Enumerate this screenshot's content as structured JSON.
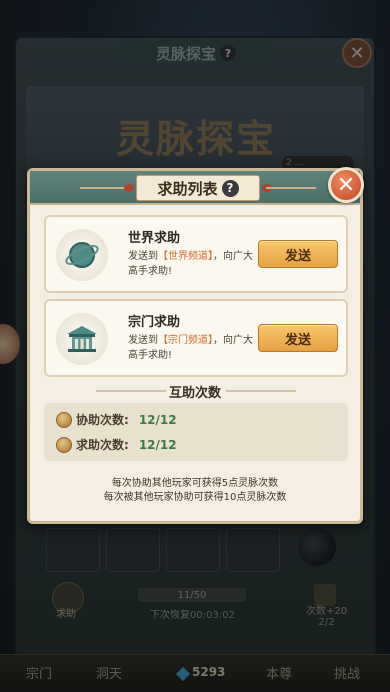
{
  "background": {
    "panel_title": "灵脉探宝",
    "banner_title": "灵脉探宝",
    "help_label": "求助",
    "progress_text": "11/50",
    "recover_label": "下次恢复",
    "recover_time": "00:03:02",
    "extra_label": "次数+20",
    "extra_sub": "2/2",
    "tag_text": "2 ..."
  },
  "nav": {
    "items": [
      "宗门",
      "洞天",
      "本尊",
      "挑战"
    ],
    "gem_count": "5293"
  },
  "modal": {
    "title": "求助列表",
    "help_icon": "?",
    "close_icon": "✕",
    "options": [
      {
        "icon": "globe-icon",
        "title": "世界求助",
        "desc_prefix": "发送到",
        "channel": "【世界频道】",
        "desc_suffix": "，向广大高手求助!",
        "button": "发送"
      },
      {
        "icon": "pavilion-icon",
        "title": "宗门求助",
        "desc_prefix": "发送到",
        "channel": "【宗门频道】",
        "desc_suffix": "，向广大高手求助!",
        "button": "发送"
      }
    ],
    "section_title": "互助次数",
    "counts": [
      {
        "label": "协助次数:",
        "value": "12/12"
      },
      {
        "label": "求助次数:",
        "value": "12/12"
      }
    ],
    "notes": [
      "每次协助其他玩家可获得5点灵脉次数",
      "每次被其他玩家协助可获得10点灵脉次数"
    ]
  },
  "colors": {
    "header": "#4d6f67",
    "accent_button": "#e6a243",
    "highlight": "#d56d2c",
    "count_value": "#3d7a45",
    "close": "#cf5a35"
  }
}
